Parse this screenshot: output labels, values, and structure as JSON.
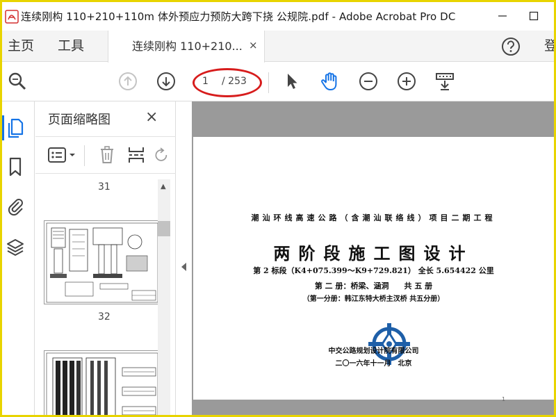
{
  "window": {
    "title": "连续刚构 110+210+110m 体外预应力预防大跨下挠 公规院.pdf - Adobe Acrobat Pro DC"
  },
  "menu": {
    "home": "主页",
    "tools": "工具",
    "login": "登"
  },
  "tab": {
    "label": "连续刚构 110+210...",
    "close": "×"
  },
  "toolbar": {
    "page_current": "1",
    "page_total": "/ 253"
  },
  "panel": {
    "title": "页面缩略图",
    "close": "×",
    "thumbs": [
      {
        "label": "31"
      },
      {
        "label": "32"
      }
    ]
  },
  "document": {
    "line1": "潮汕环线高速公路（含潮汕联络线）项目二期工程",
    "title": "两阶段施工图设计",
    "line2": "第 2 标段（K4+075.399～K9+729.821） 全长 5.654422 公里",
    "line3": "第 二 册：桥梁、涵洞　　共 五 册",
    "line4": "（第一分册：韩江东特大桥主汊桥 共五分册）",
    "org": "中交公路规划设计院有限公司",
    "date": "二〇一六年十一月　北京",
    "page_number": "1"
  },
  "colors": {
    "accent": "#1473e6",
    "highlight": "#d71c1c",
    "frame": "#e8d400",
    "logo_blue": "#1e5fa8"
  }
}
